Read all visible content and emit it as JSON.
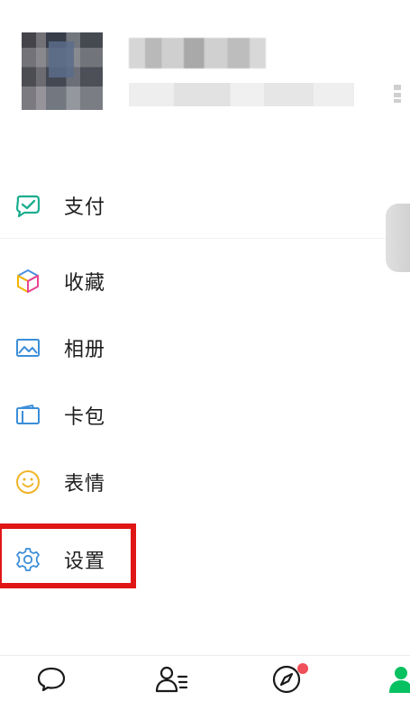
{
  "menu": {
    "items": [
      {
        "label": "支付",
        "icon": "wechat-pay-icon"
      },
      {
        "label": "收藏",
        "icon": "favorites-cube-icon"
      },
      {
        "label": "相册",
        "icon": "album-icon"
      },
      {
        "label": "卡包",
        "icon": "card-wallet-icon"
      },
      {
        "label": "表情",
        "icon": "emoji-smile-icon"
      },
      {
        "label": "设置",
        "icon": "settings-gear-icon"
      }
    ]
  },
  "highlight": {
    "target": "设置",
    "color": "#e01515"
  },
  "tabbar": {
    "tabs": [
      {
        "icon": "chats-icon",
        "active": false
      },
      {
        "icon": "contacts-icon",
        "active": false
      },
      {
        "icon": "discover-icon",
        "active": false,
        "badge": true
      },
      {
        "icon": "me-icon",
        "active": true
      }
    ],
    "active_color": "#07c160",
    "badge_color": "#f0505a"
  }
}
